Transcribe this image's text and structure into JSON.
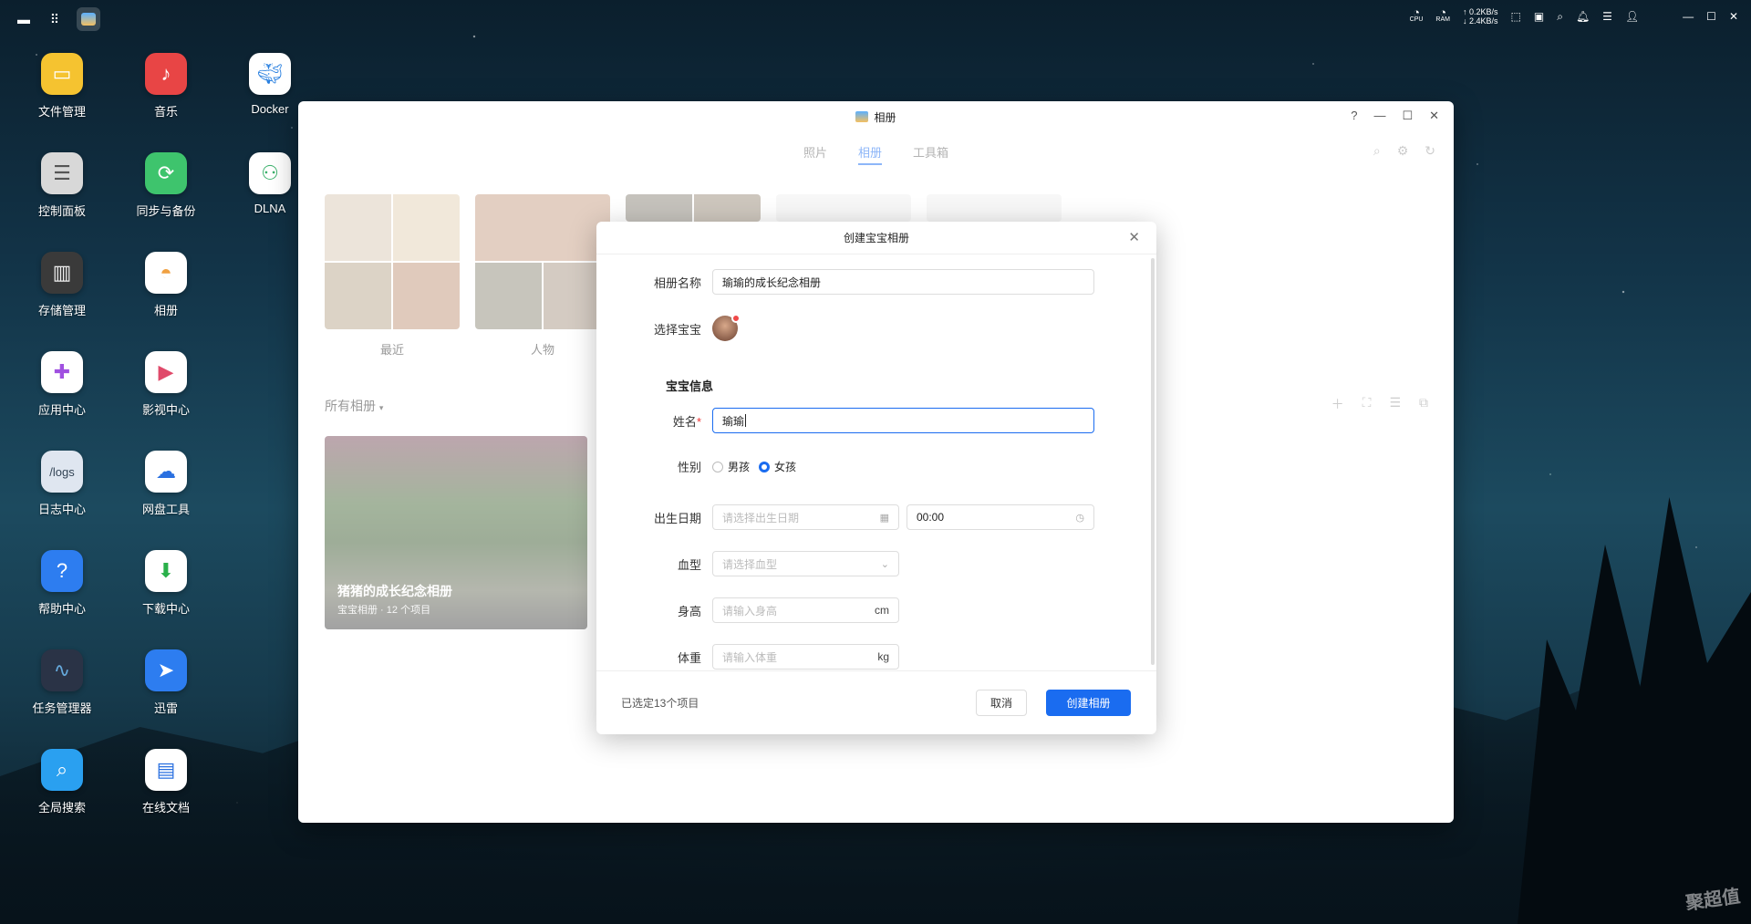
{
  "topbar": {
    "icons_left": [
      "monitor-icon",
      "grid-icon",
      "album-app-icon"
    ],
    "cpu_label": "CPU",
    "ram_label": "RAM",
    "net_up": "↑ 0.2KB/s",
    "net_down": "↓ 2.4KB/s"
  },
  "desktop": {
    "items": [
      {
        "label": "文件管理",
        "icon": "folder-icon",
        "color": "#f5c330"
      },
      {
        "label": "音乐",
        "icon": "music-icon",
        "color": "#e84545"
      },
      {
        "label": "Docker",
        "icon": "docker-icon",
        "color": "#ffffff"
      },
      {
        "label": "控制面板",
        "icon": "control-panel-icon",
        "color": "#d8d8d8"
      },
      {
        "label": "同步与备份",
        "icon": "sync-icon",
        "color": "#3ec46d"
      },
      {
        "label": "DLNA",
        "icon": "dlna-icon",
        "color": "#ffffff"
      },
      {
        "label": "存储管理",
        "icon": "storage-icon",
        "color": "#3a3a3a"
      },
      {
        "label": "相册",
        "icon": "photos-icon",
        "color": "#ffffff"
      },
      {
        "label": "应用中心",
        "icon": "app-center-icon",
        "color": "#ffffff"
      },
      {
        "label": "影视中心",
        "icon": "video-icon",
        "color": "#ffffff"
      },
      {
        "label": "日志中心",
        "icon": "logs-icon",
        "color": "#dfe6f0"
      },
      {
        "label": "网盘工具",
        "icon": "cloud-drive-icon",
        "color": "#ffffff"
      },
      {
        "label": "帮助中心",
        "icon": "help-icon",
        "color": "#2d7df0"
      },
      {
        "label": "下载中心",
        "icon": "download-icon",
        "color": "#ffffff"
      },
      {
        "label": "任务管理器",
        "icon": "task-manager-icon",
        "color": "#2a3346"
      },
      {
        "label": "迅雷",
        "icon": "thunder-icon",
        "color": "#2d7df0"
      },
      {
        "label": "全局搜索",
        "icon": "search-app-icon",
        "color": "#2aa0f0"
      },
      {
        "label": "在线文档",
        "icon": "docs-icon",
        "color": "#ffffff"
      }
    ],
    "logs_text": "/logs"
  },
  "window": {
    "title": "相册",
    "tabs": [
      "照片",
      "相册",
      "工具箱"
    ],
    "active_tab": "相册",
    "covers": [
      {
        "label": "最近"
      },
      {
        "label": "人物"
      }
    ],
    "section_title": "所有相册",
    "album": {
      "title": "猪猪的成长纪念相册",
      "subtitle": "宝宝相册 · 12 个项目"
    }
  },
  "dialog": {
    "title": "创建宝宝相册",
    "album_name_label": "相册名称",
    "album_name_value": "瑜瑜的成长纪念相册",
    "select_baby_label": "选择宝宝",
    "baby_info_title": "宝宝信息",
    "name_label": "姓名",
    "name_value": "瑜瑜",
    "gender_label": "性别",
    "gender_options": [
      "男孩",
      "女孩"
    ],
    "gender_selected": "女孩",
    "birth_label": "出生日期",
    "birth_placeholder": "请选择出生日期",
    "birth_time": "00:00",
    "blood_label": "血型",
    "blood_placeholder": "请选择血型",
    "height_label": "身高",
    "height_placeholder": "请输入身高",
    "height_unit": "cm",
    "weight_label": "体重",
    "weight_placeholder": "请输入体重",
    "weight_unit": "kg",
    "selected_info": "已选定13个项目",
    "cancel_label": "取消",
    "create_label": "创建相册"
  },
  "watermark": "聚超值",
  "colors": {
    "accent": "#1a6cf0",
    "required": "#e33333"
  }
}
